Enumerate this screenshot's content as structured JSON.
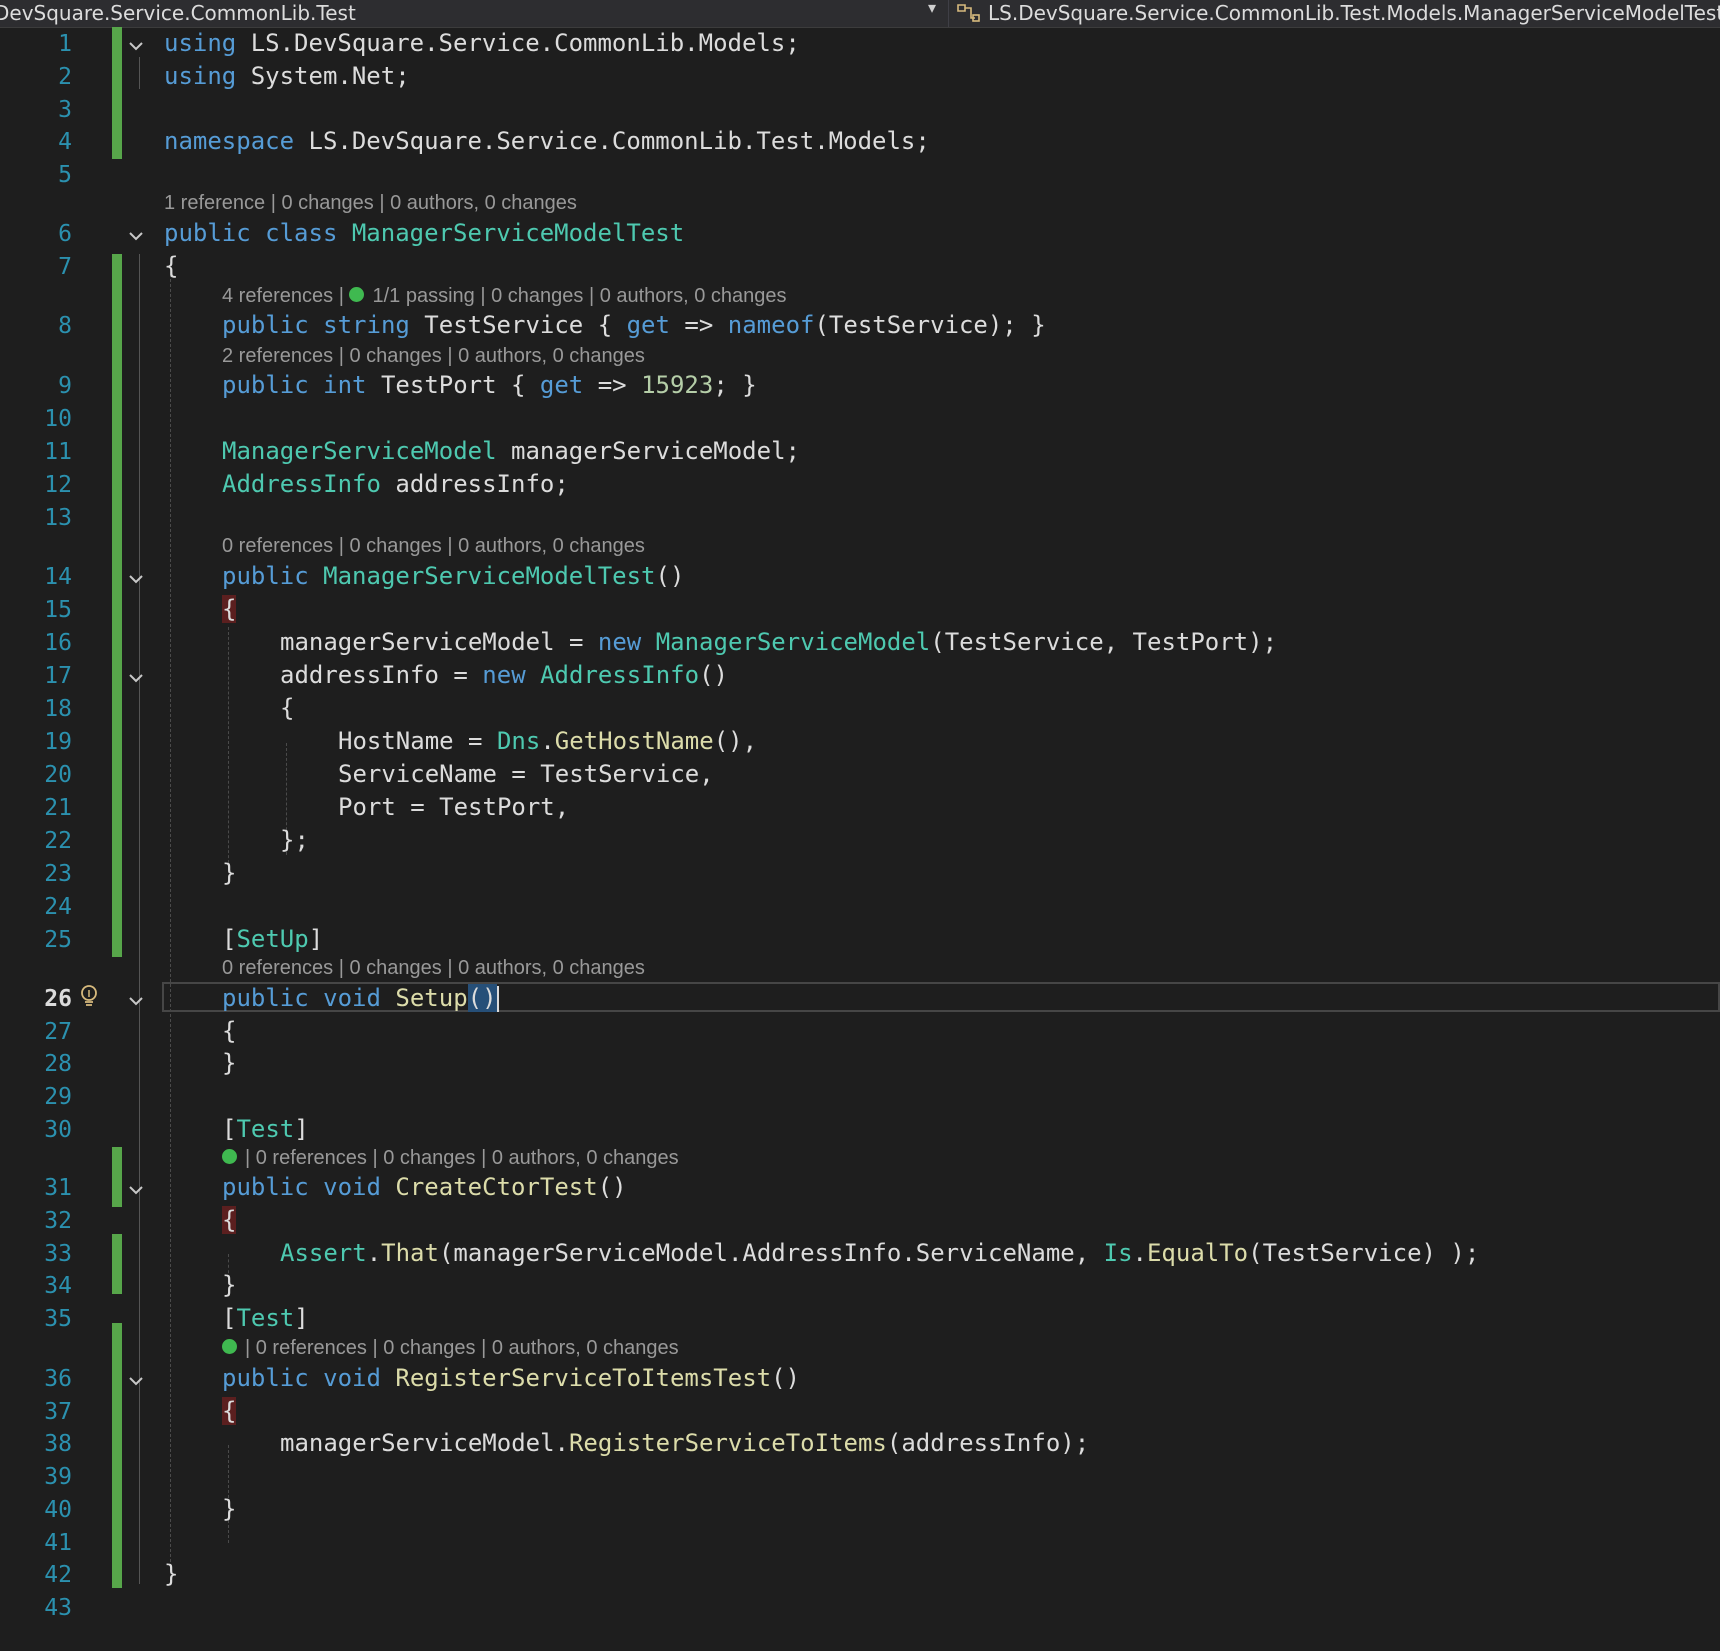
{
  "navbar": {
    "project": "DevSquare.Service.CommonLib.Test",
    "type_member": "LS.DevSquare.Service.CommonLib.Test.Models.ManagerServiceModelTest"
  },
  "editor": {
    "current_line": "26",
    "line_numbers": [
      "1",
      "2",
      "3",
      "4",
      "5",
      "6",
      "7",
      "8",
      "9",
      "10",
      "11",
      "12",
      "13",
      "14",
      "15",
      "16",
      "17",
      "18",
      "19",
      "20",
      "21",
      "22",
      "23",
      "24",
      "25",
      "26",
      "27",
      "28",
      "29",
      "30",
      "31",
      "32",
      "33",
      "34",
      "35",
      "36",
      "37",
      "38",
      "39",
      "40",
      "41",
      "42",
      "43"
    ],
    "codelens": {
      "class": "1 reference | 0 changes | 0 authors, 0 changes",
      "test_service_a": "4 references | ",
      "test_service_b": "1/1 passing | 0 changes | 0 authors, 0 changes",
      "test_port": "2 references | 0 changes | 0 authors, 0 changes",
      "ctor": "0 references | 0 changes | 0 authors, 0 changes",
      "setup": "0 references | 0 changes | 0 authors, 0 changes",
      "create_ctor_test": "| 0 references | 0 changes | 0 authors, 0 changes",
      "register_test": "| 0 references | 0 changes | 0 authors, 0 changes"
    }
  },
  "colors": {
    "background": "#1e1e1e",
    "keyword": "#569cd6",
    "type": "#4ec9b0",
    "method": "#dcdcaa",
    "number": "#b5cea8",
    "line_number": "#2b91af",
    "change_bar": "#57a64a",
    "test_pass": "#3fb950"
  }
}
